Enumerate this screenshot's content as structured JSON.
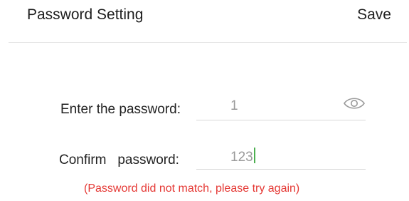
{
  "header": {
    "title": "Password Setting",
    "save_label": "Save"
  },
  "form": {
    "enter_label": "Enter the password:",
    "enter_value": "1",
    "confirm_label": "Confirm   password:",
    "confirm_value": "123",
    "error_message": "(Password did not match, please try again)"
  },
  "icons": {
    "visibility": "eye-icon"
  },
  "colors": {
    "error": "#e53935",
    "cursor": "#4caf50",
    "value_text": "#9a9a9a"
  }
}
